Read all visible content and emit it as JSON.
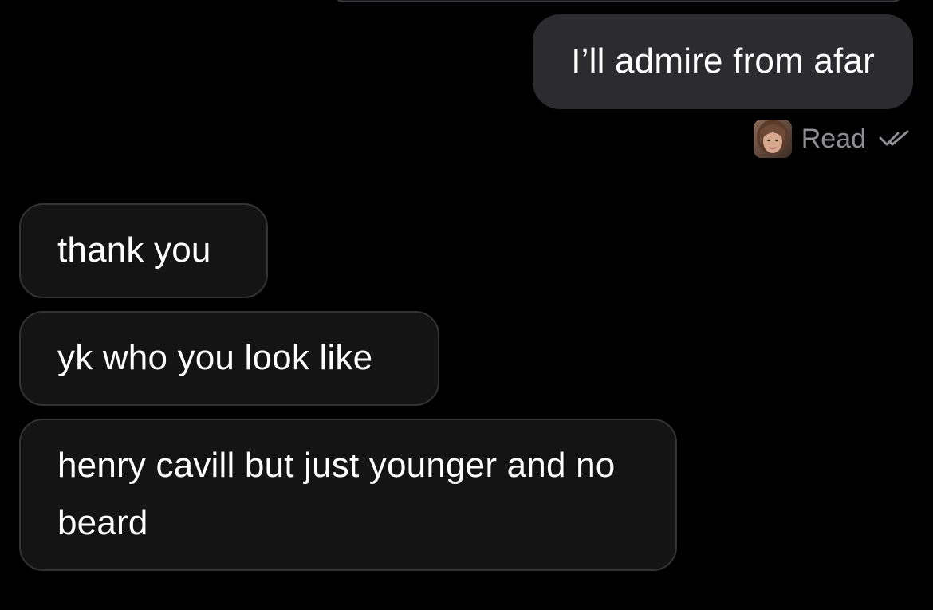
{
  "conversation": {
    "messages": [
      {
        "direction": "outgoing",
        "text": "I’ll admire from afar"
      },
      {
        "direction": "incoming",
        "text": "thank you"
      },
      {
        "direction": "incoming",
        "text": "yk who you look like"
      },
      {
        "direction": "incoming",
        "text": "henry cavill but just younger and no beard"
      }
    ],
    "read_receipt": {
      "label": "Read",
      "icon": "double-check-icon",
      "avatar": "user-avatar"
    }
  },
  "colors": {
    "background": "#000000",
    "outgoing_bubble": "#2c2c2e",
    "incoming_bubble": "#141414",
    "incoming_border": "#333335",
    "text": "#ffffff",
    "meta_text": "#8e8e93"
  }
}
